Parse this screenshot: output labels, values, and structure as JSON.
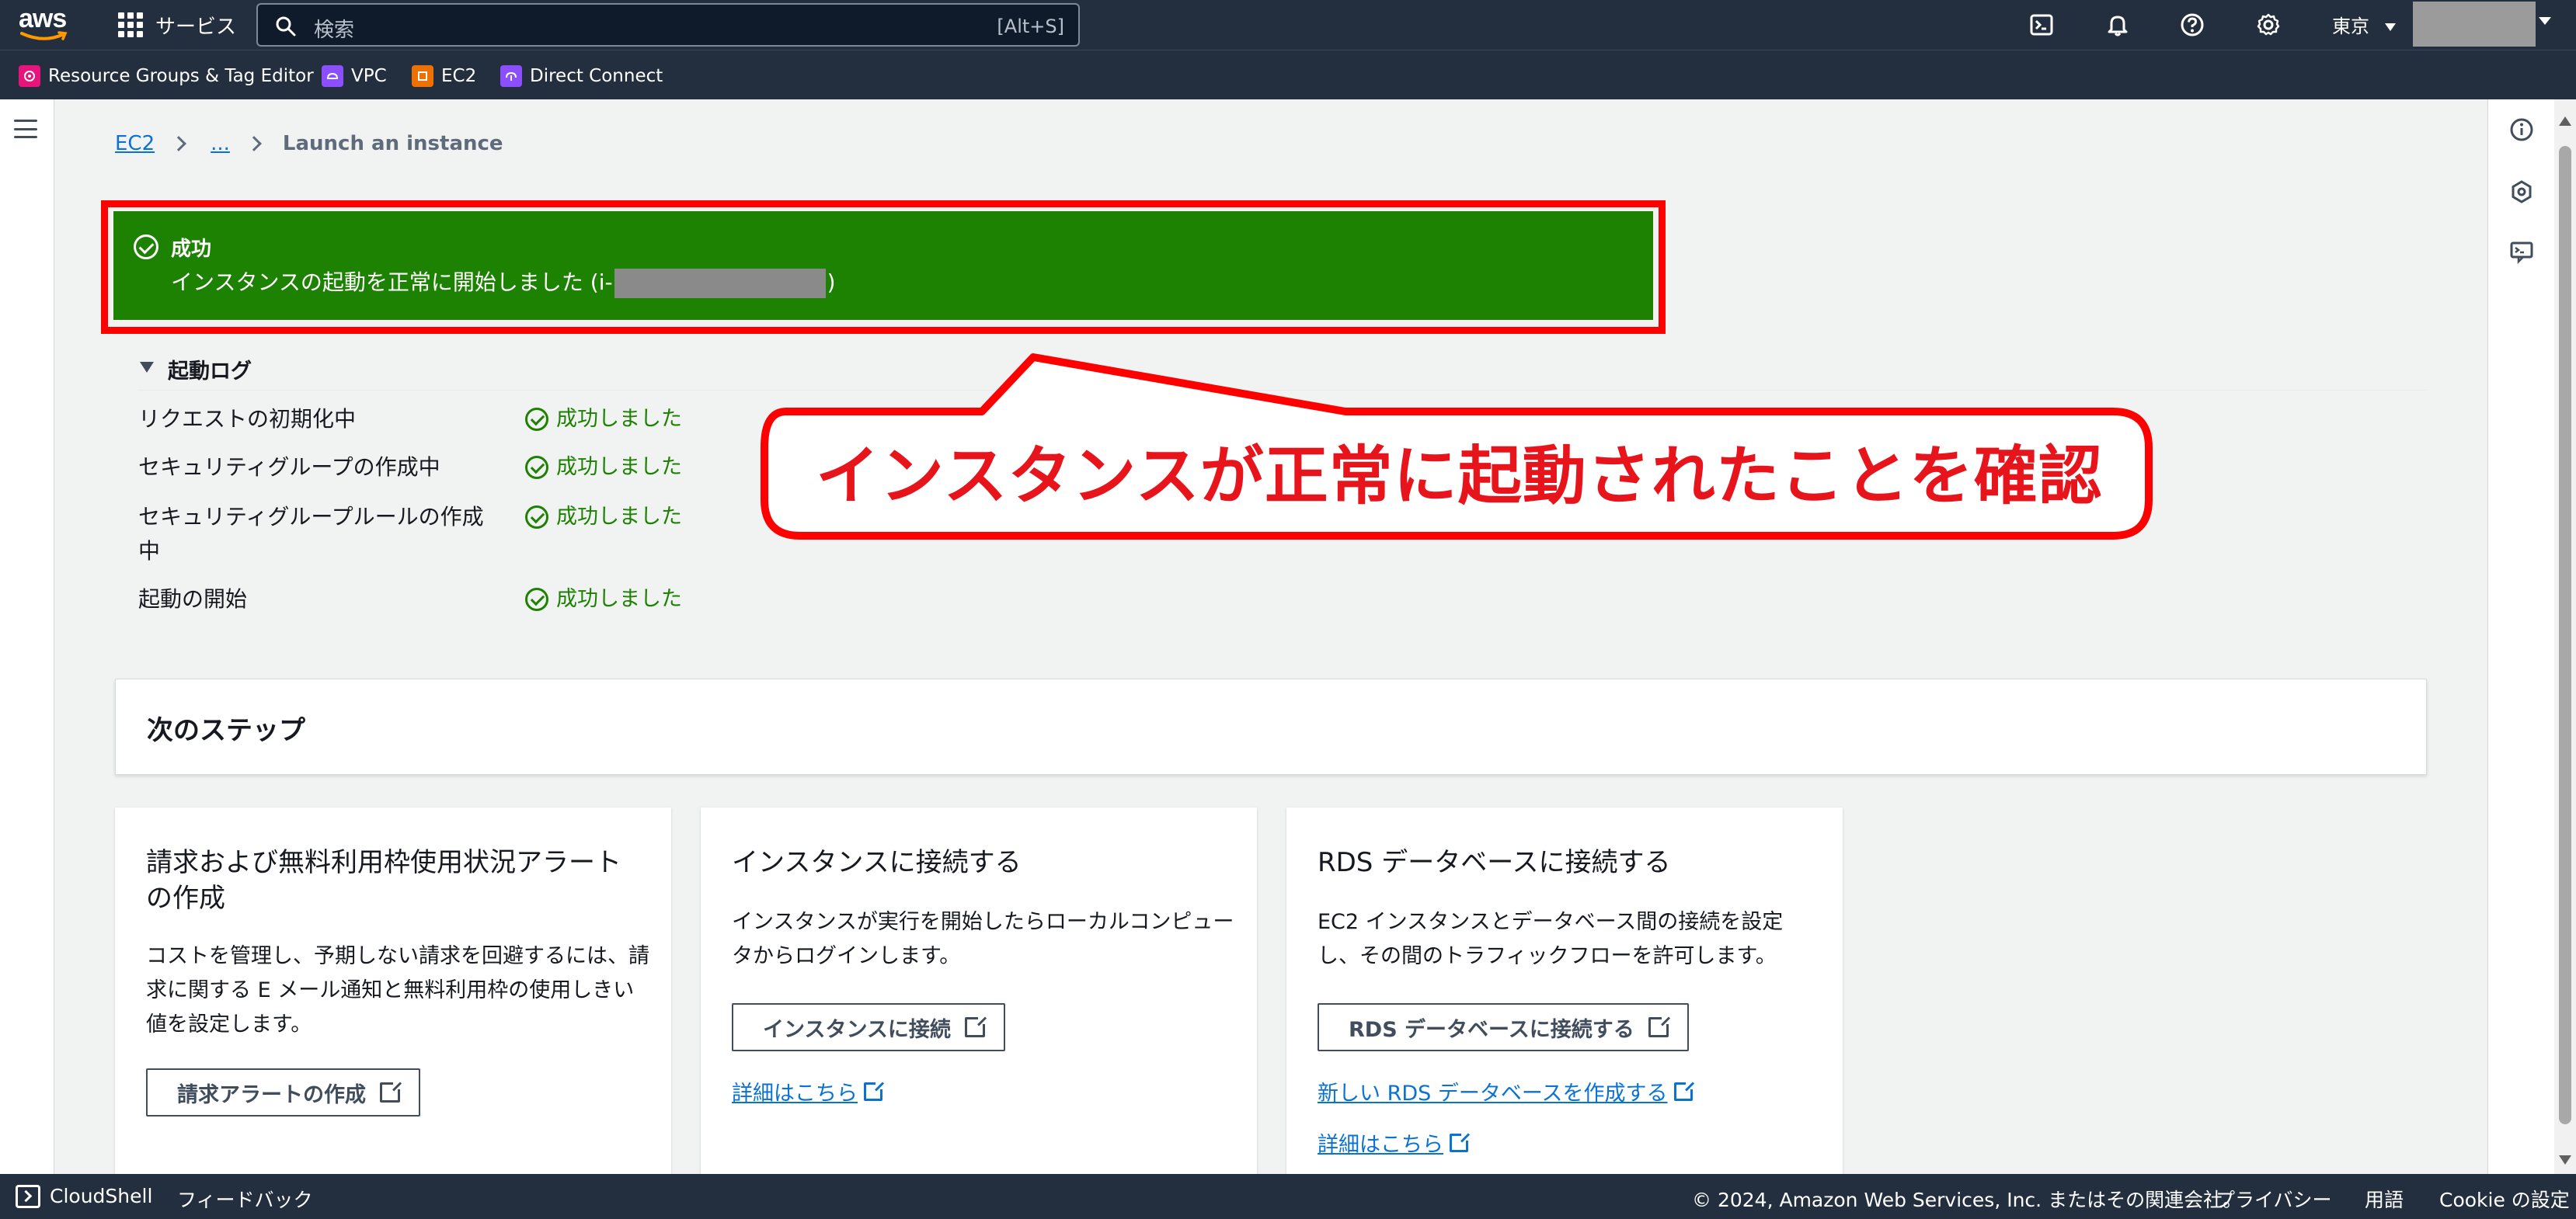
{
  "topnav": {
    "logo": "aws",
    "services_label": "サービス",
    "search_placeholder": "検索",
    "search_shortcut": "[Alt+S]",
    "region": "東京"
  },
  "favorites": [
    {
      "label": "Resource Groups & Tag Editor",
      "color": "#e7157b"
    },
    {
      "label": "VPC",
      "color": "#8c4fff"
    },
    {
      "label": "EC2",
      "color": "#ed7100"
    },
    {
      "label": "Direct Connect",
      "color": "#8c4fff"
    }
  ],
  "breadcrumb": {
    "root": "EC2",
    "ellipsis": "...",
    "current": "Launch an instance"
  },
  "flash": {
    "title": "成功",
    "message_prefix": "インスタンスの起動を正常に開始しました (i-",
    "message_suffix": ")"
  },
  "launch_log": {
    "header": "起動ログ",
    "rows": [
      {
        "label": "リクエストの初期化中",
        "status": "成功しました"
      },
      {
        "label": "セキュリティグループの作成中",
        "status": "成功しました"
      },
      {
        "label": "セキュリティグループルールの作成中",
        "status": "成功しました"
      },
      {
        "label": "起動の開始",
        "status": "成功しました"
      }
    ]
  },
  "annotation": {
    "text": "インスタンスが正常に起動されたことを確認",
    "color": "#ff0000"
  },
  "next_steps": {
    "title": "次のステップ",
    "cards": [
      {
        "title": "請求および無料利用枠使用状況アラートの作成",
        "description": "コストを管理し、予期しない請求を回避するには、請求に関する E メール通知と無料利用枠の使用しきい値を設定します。",
        "button": "請求アラートの作成"
      },
      {
        "title": "インスタンスに接続する",
        "description": "インスタンスが実行を開始したらローカルコンピュータからログインします。",
        "button": "インスタンスに接続",
        "link": "詳細はこちら"
      },
      {
        "title": "RDS データベースに接続する",
        "description": "EC2 インスタンスとデータベース間の接続を設定し、その間のトラフィックフローを許可します。",
        "button": "RDS データベースに接続する",
        "link": "新しい RDS データベースを作成する",
        "link2": "詳細はこちら"
      }
    ]
  },
  "footer": {
    "cloudshell": "CloudShell",
    "feedback": "フィードバック",
    "copyright": "© 2024, Amazon Web Services, Inc. またはその関連会社。",
    "privacy": "プライバシー",
    "terms": "用語",
    "cookie": "Cookie の設定"
  },
  "colors": {
    "nav_bg": "#232f3e",
    "success": "#1d8102",
    "link": "#0972d3"
  }
}
